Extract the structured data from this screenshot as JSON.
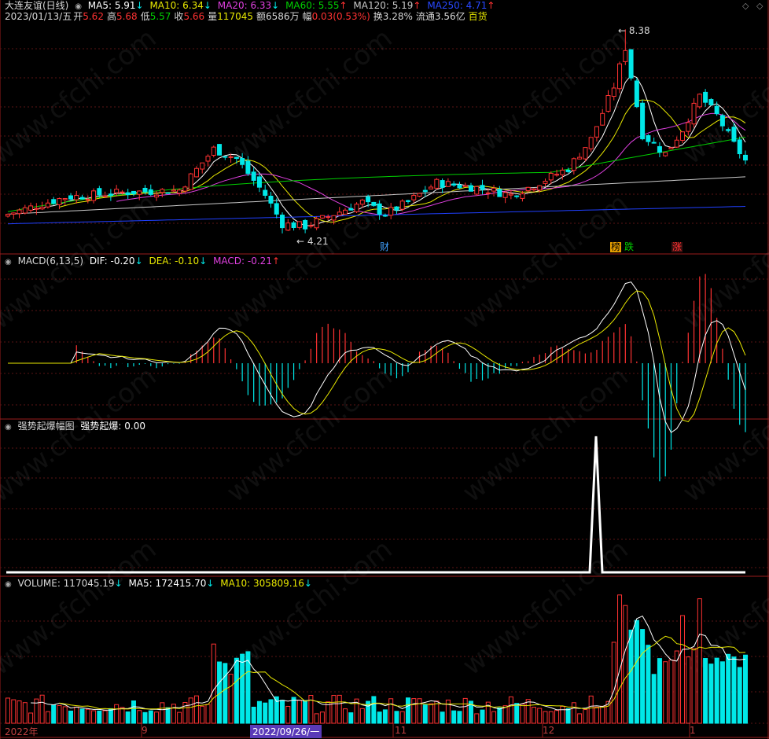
{
  "header": {
    "title": "大连友谊(日线)",
    "ma5": "MA5: 5.91",
    "ma5_arrow": "↓",
    "ma10": "MA10: 6.34",
    "ma10_arrow": "↓",
    "ma20": "MA20: 6.33",
    "ma20_arrow": "↓",
    "ma60": "MA60: 5.55",
    "ma60_arrow": "↑",
    "ma120": "MA120: 5.19",
    "ma120_arrow": "↑",
    "ma250": "MA250: 4.71",
    "ma250_arrow": "↑"
  },
  "quote": {
    "date": "2023/01/13/五",
    "open_label": "开",
    "open": "5.62",
    "high_label": "高",
    "high": "5.68",
    "low_label": "低",
    "low": "5.57",
    "close_label": "收",
    "close": "5.66",
    "vol_label": "量",
    "vol": "117045",
    "amount_label": "额",
    "amount": "6586万",
    "change_label": "幅",
    "change": "0.03(0.53%)",
    "turnover_label": "换",
    "turnover": "3.28%",
    "float_label": "流通",
    "float": "3.56亿",
    "sector": "百货"
  },
  "macd_header": {
    "name": "MACD(6,13,5)",
    "dif": "DIF: -0.20",
    "dif_arrow": "↓",
    "dea": "DEA: -0.10",
    "dea_arrow": "↓",
    "macd": "MACD: -0.21",
    "macd_arrow": "↑"
  },
  "burst_header": {
    "name": "强势起爆幅图",
    "value": "强势起爆: 0.00"
  },
  "vol_header": {
    "vol": "VOLUME: 117045.19",
    "vol_arrow": "↓",
    "ma5": "MA5: 172415.70",
    "ma5_arrow": "↓",
    "ma10": "MA10: 305809.16",
    "ma10_arrow": "↓"
  },
  "annotations": {
    "high": "8.38",
    "low": "4.21"
  },
  "tags": {
    "cai": "财",
    "bang": "榜",
    "die": "跌",
    "zhang": "涨"
  },
  "xaxis": {
    "year": "2022年",
    "sep": "9",
    "cursor_date": "2022/09/26/一",
    "nov": "11",
    "dec": "12",
    "jan": "1"
  },
  "watermark": "www.cfchi.com",
  "colors": {
    "up": "#ff3232",
    "down": "#00e8e8",
    "ma5": "#ffffff",
    "ma10": "#e8e800",
    "ma20": "#e040e0",
    "ma60": "#00d000",
    "ma120": "#c8c8c8",
    "ma250": "#2040ff"
  },
  "chart_data": {
    "type": "candlestick",
    "price_high": 8.38,
    "price_low": 4.21,
    "last_bar": {
      "open": 5.62,
      "high": 5.68,
      "low": 5.57,
      "close": 5.66,
      "volume": 117045
    },
    "ma_last": {
      "MA5": 5.91,
      "MA10": 6.34,
      "MA20": 6.33,
      "MA60": 5.55,
      "MA120": 5.19,
      "MA250": 4.71
    },
    "macd_last": {
      "DIF": -0.2,
      "DEA": -0.1,
      "MACD": -0.21
    },
    "burst_last": 0.0,
    "volume_ma_last": {
      "MA5": 172415.7,
      "MA10": 305809.16
    }
  }
}
